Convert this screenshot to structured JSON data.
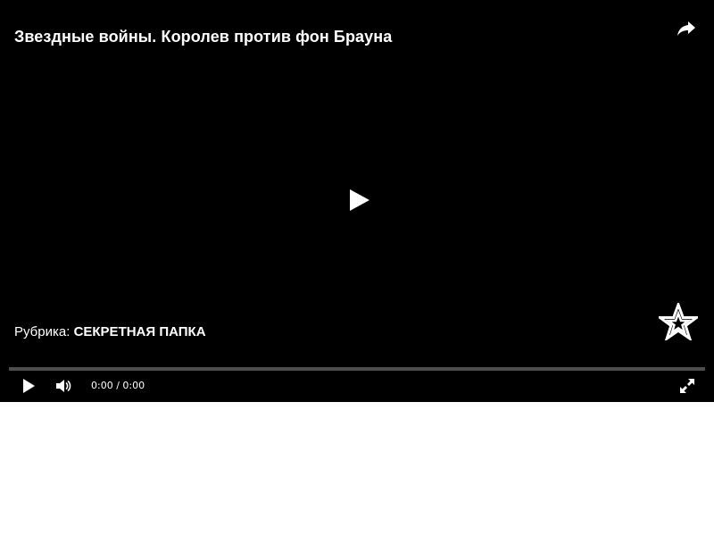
{
  "video": {
    "title": "Звездные войны. Королев против фон Брауна",
    "rubric_label": "Рубрика:",
    "rubric_value": "СЕКРЕТНАЯ ПАПКА"
  },
  "controls": {
    "current_time": "0:00",
    "separator": "/",
    "duration": "0:00",
    "progress": 0
  },
  "icons": {
    "share": "share-icon",
    "big_play": "play-icon",
    "play": "play-icon",
    "volume": "volume-icon",
    "fullscreen": "fullscreen-icon",
    "logo": "star-logo-icon"
  },
  "colors": {
    "background": "#000000",
    "text": "#ffffff",
    "progress_track": "#4d4d4d"
  }
}
